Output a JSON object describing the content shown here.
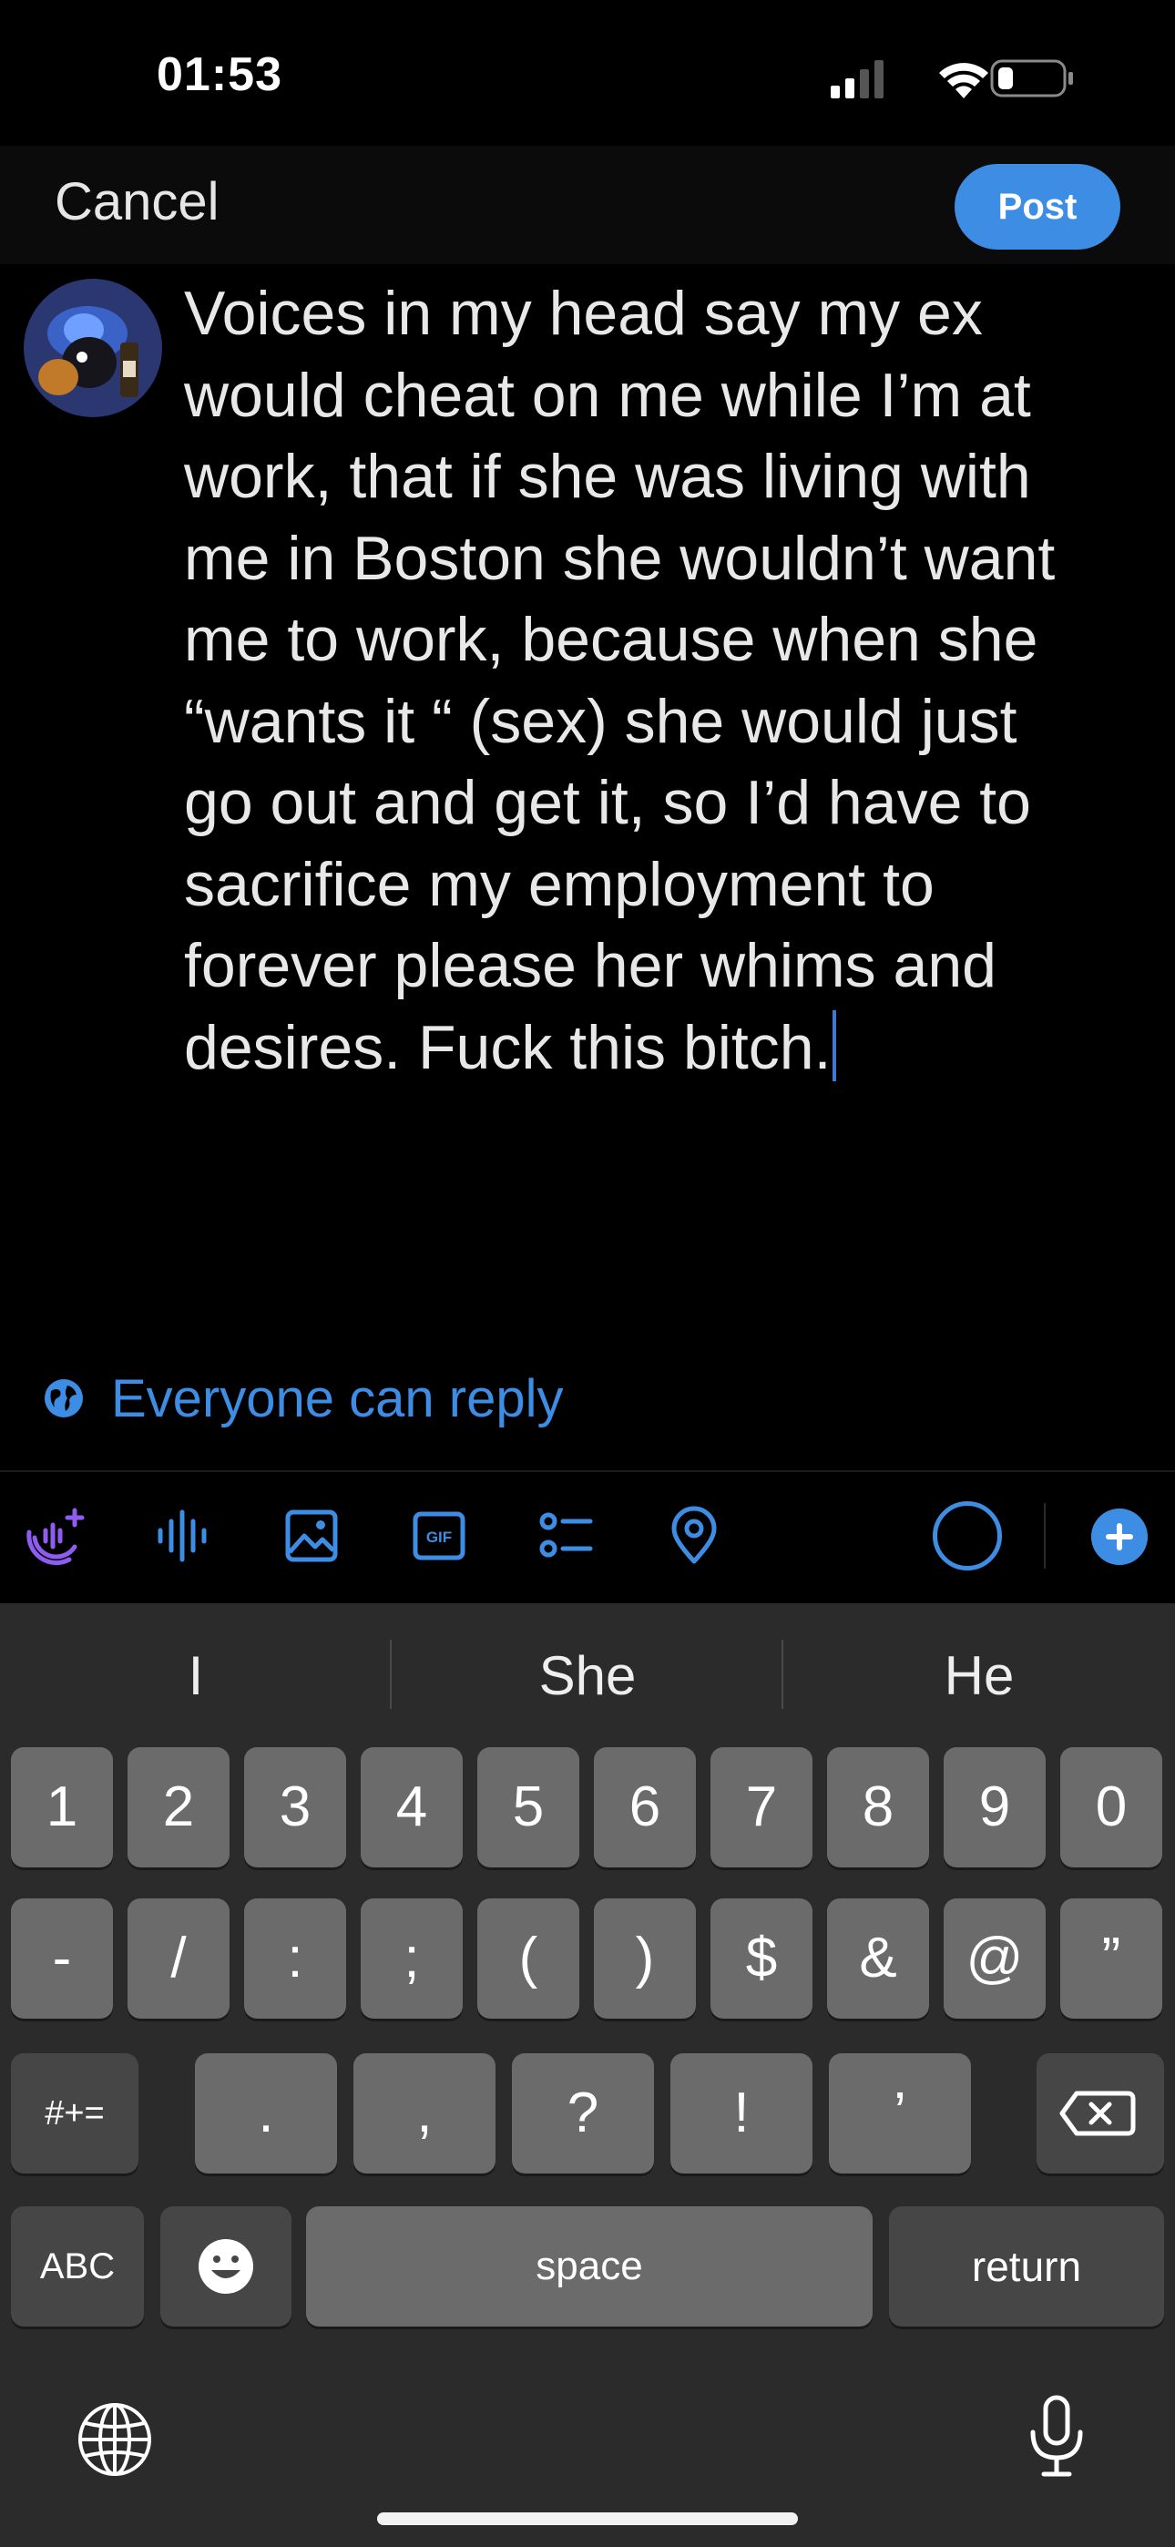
{
  "status_bar": {
    "time": "01:53"
  },
  "header": {
    "cancel_label": "Cancel",
    "post_label": "Post"
  },
  "composer": {
    "text": "Voices in my head say my ex\nwould cheat on me while I’m at\nwork, that if she was living with\nme in Boston she wouldn’t want\nme to work, because when she\n“wants it “ (sex) she would just\ngo out and get it, so I’d have to\nsacrifice my employment to\nforever please her whims and\ndesires. Fuck this bitch."
  },
  "reply_setting": {
    "label": "Everyone can reply"
  },
  "toolbar": {
    "icons": [
      "add-audio-space-icon",
      "voice-icon",
      "image-icon",
      "gif-icon",
      "poll-icon",
      "location-icon"
    ],
    "gif_label": "GIF"
  },
  "keyboard": {
    "suggestions": [
      "I",
      "She",
      "He"
    ],
    "row1": [
      "1",
      "2",
      "3",
      "4",
      "5",
      "6",
      "7",
      "8",
      "9",
      "0"
    ],
    "row2": [
      "-",
      "/",
      ":",
      ";",
      "(",
      ")",
      "$",
      "&",
      "@",
      "”"
    ],
    "row3_mode": "#+=",
    "row3": [
      ".",
      ",",
      "?",
      "!",
      "’"
    ],
    "abc_label": "ABC",
    "space_label": "space",
    "return_label": "return"
  },
  "colors": {
    "accent": "#3d8de4",
    "background": "#000000",
    "keyboard_bg": "#2b2b2b"
  }
}
